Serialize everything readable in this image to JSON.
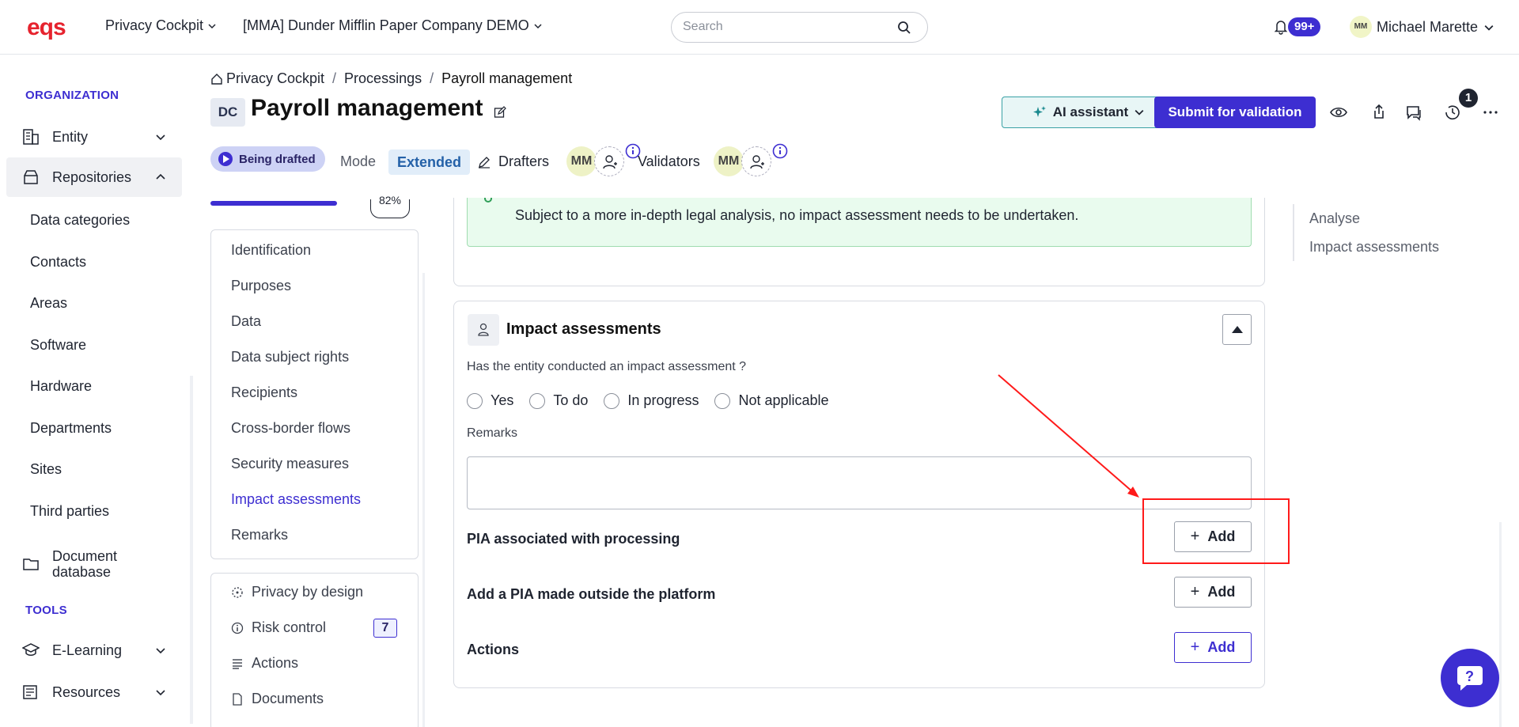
{
  "topbar": {
    "app_menu": "Privacy Cockpit",
    "company": "[MMA] Dunder Mifflin Paper Company DEMO",
    "search_placeholder": "Search",
    "notifications_count": "99+",
    "user_initials": "MM",
    "user_name": "Michael Marette"
  },
  "sidebar": {
    "section_org": "ORGANIZATION",
    "entity": "Entity",
    "repositories": "Repositories",
    "sub_items": [
      "Data categories",
      "Contacts",
      "Areas",
      "Software",
      "Hardware",
      "Departments",
      "Sites",
      "Third parties"
    ],
    "document_db_line1": "Document",
    "document_db_line2": "database",
    "section_tools": "TOOLS",
    "elearning": "E-Learning",
    "resources": "Resources"
  },
  "breadcrumb": {
    "root": "Privacy Cockpit",
    "sep": "/",
    "parent": "Processings",
    "current": "Payroll management"
  },
  "header": {
    "chip": "DC",
    "title": "Payroll management",
    "ai_label": "AI assistant",
    "submit_label": "Submit for validation",
    "history_badge": "1",
    "status": "Being drafted",
    "mode_label": "Mode",
    "mode_value": "Extended",
    "drafters_label": "Drafters",
    "validators_label": "Validators",
    "drafter_initials": "MM",
    "validator_initials": "MM"
  },
  "progress": {
    "percent_text": "82%"
  },
  "nav": {
    "items": [
      "Identification",
      "Purposes",
      "Data",
      "Data subject rights",
      "Recipients",
      "Cross-border flows",
      "Security measures",
      "Impact assessments",
      "Remarks"
    ],
    "active": "Impact assessments",
    "tools": [
      "Privacy by design",
      "Risk control",
      "Actions",
      "Documents"
    ],
    "risk_count": "7"
  },
  "previous_section": {
    "note": "Subject to a more in-depth legal analysis, no impact assessment needs to be undertaken."
  },
  "impact": {
    "title": "Impact assessments",
    "question": "Has the entity conducted an impact assessment ?",
    "options": [
      "Yes",
      "To do",
      "In progress",
      "Not applicable"
    ],
    "remarks_label": "Remarks",
    "remarks_value": "",
    "pia_label": "PIA associated with processing",
    "pia_outside_label": "Add a PIA made outside the platform",
    "actions_label": "Actions",
    "add_label": "Add"
  },
  "toc": {
    "items": [
      "Analyse",
      "Impact assessments"
    ]
  },
  "colors": {
    "brand": "#3d2ed1",
    "logo_red": "#e6232e",
    "annotation": "#ff1a1a",
    "success_bg": "#e9fbee"
  },
  "icons": [
    "search-icon",
    "bell-icon",
    "chevron-down-icon",
    "building-icon",
    "archive-icon",
    "folder-icon",
    "graduation-cap-icon",
    "newspaper-icon",
    "home-icon",
    "edit-icon",
    "sparkle-icon",
    "eye-icon",
    "share-icon",
    "comment-icon",
    "history-icon",
    "more-icon",
    "info-icon",
    "user-add-icon",
    "user-icon",
    "plus-icon",
    "help-chat-icon"
  ]
}
